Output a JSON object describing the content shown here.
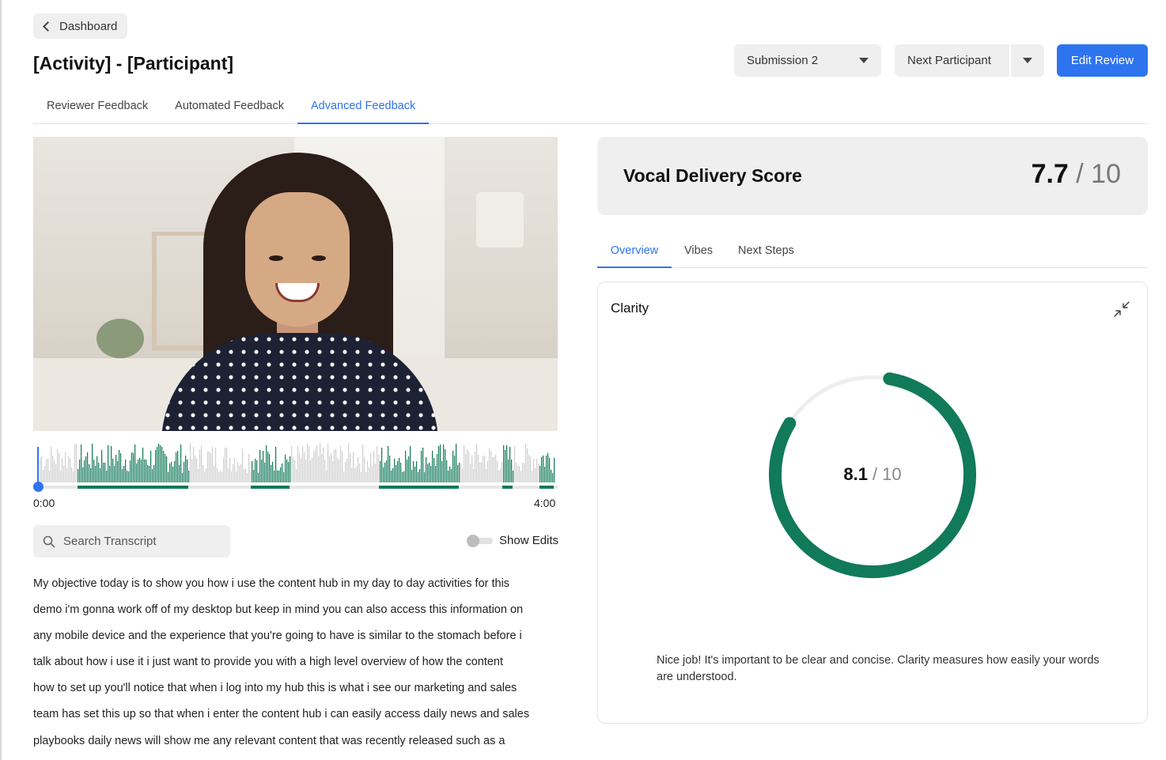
{
  "nav": {
    "back_label": "Dashboard"
  },
  "page": {
    "title": "[Activity] - [Participant]"
  },
  "tabs": [
    {
      "label": "Reviewer Feedback",
      "active": false
    },
    {
      "label": "Automated Feedback",
      "active": false
    },
    {
      "label": "Advanced Feedback",
      "active": true
    }
  ],
  "toolbar": {
    "submission_selected": "Submission 2",
    "next_participant_label": "Next Participant",
    "edit_review_label": "Edit Review"
  },
  "player": {
    "time_start": "0:00",
    "time_end": "4:00",
    "progress": 0
  },
  "transcript_tools": {
    "search_placeholder": "Search Transcript",
    "show_edits_label": "Show Edits",
    "show_edits_on": false
  },
  "transcript": {
    "lines": [
      "My objective today is to show you how i use the content hub in my day to day activities for this",
      "demo i'm gonna work off of my desktop but keep in mind you can also access this information on",
      "any mobile device and the experience that you're going to have is similar to the stomach before i",
      "talk about how i use it i just want to provide you with a high level overview of how the content",
      "how to set up you'll notice that when i log into my hub this is what i see our marketing and sales",
      "team has set this up so that when i enter the content hub i can easily access daily news and sales",
      "playbooks daily news will show me any relevant content that was recently released such as a"
    ]
  },
  "score": {
    "label": "Vocal Delivery Score",
    "value": "7.7",
    "max": "/ 10"
  },
  "sub_tabs": [
    {
      "label": "Overview",
      "active": true
    },
    {
      "label": "Vibes",
      "active": false
    },
    {
      "label": "Next Steps",
      "active": false
    }
  ],
  "clarity": {
    "title": "Clarity",
    "value": "8.1",
    "max": "/ 10",
    "fraction": 0.81,
    "description": "Nice job! It's important to be clear and concise. Clarity measures how easily your words are understood."
  },
  "colors": {
    "accent": "#2f74ef",
    "ring": "#117a58",
    "ring_track": "#eeeeee"
  }
}
